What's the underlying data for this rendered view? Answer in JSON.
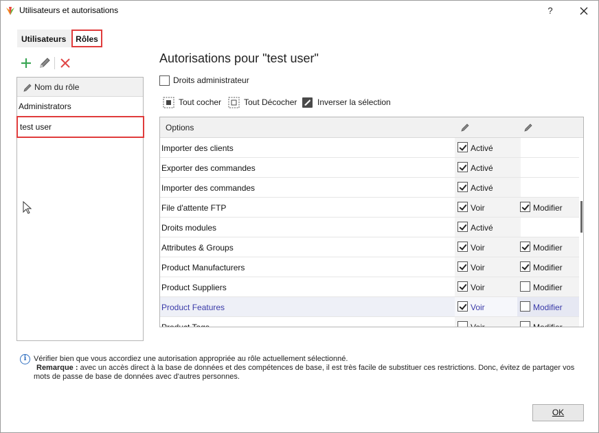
{
  "window": {
    "title": "Utilisateurs et autorisations",
    "help_label": "?"
  },
  "tabs": [
    {
      "label": "Utilisateurs",
      "active": false
    },
    {
      "label": "Rôles",
      "active": true
    }
  ],
  "role_toolbar": {
    "icons": [
      "add-icon",
      "edit-icon",
      "delete-icon"
    ]
  },
  "roles": {
    "header": "Nom du rôle",
    "items": [
      {
        "label": "Administrators",
        "selected": false
      },
      {
        "label": "test user",
        "selected": true
      }
    ]
  },
  "permissions": {
    "title": "Autorisations pour \"test user\"",
    "admin_rights": {
      "label": "Droits administrateur",
      "checked": false
    },
    "toolbar": {
      "check_all": "Tout cocher",
      "uncheck_all": "Tout Décocher",
      "invert": "Inverser la sélection"
    },
    "grid_header": "Options",
    "rows": [
      {
        "name": "Importer des clients",
        "c1_label": "Activé",
        "c1": true,
        "c2_label": "",
        "c2": null
      },
      {
        "name": "Exporter des commandes",
        "c1_label": "Activé",
        "c1": true,
        "c2_label": "",
        "c2": null
      },
      {
        "name": "Importer des commandes",
        "c1_label": "Activé",
        "c1": true,
        "c2_label": "",
        "c2": null
      },
      {
        "name": "File d'attente FTP",
        "c1_label": "Voir",
        "c1": true,
        "c2_label": "Modifier",
        "c2": true
      },
      {
        "name": "Droits modules",
        "c1_label": "Activé",
        "c1": true,
        "c2_label": "",
        "c2": null
      },
      {
        "name": "Attributes & Groups",
        "c1_label": "Voir",
        "c1": true,
        "c2_label": "Modifier",
        "c2": true
      },
      {
        "name": "Product Manufacturers",
        "c1_label": "Voir",
        "c1": true,
        "c2_label": "Modifier",
        "c2": true
      },
      {
        "name": "Product Suppliers",
        "c1_label": "Voir",
        "c1": true,
        "c2_label": "Modifier",
        "c2": false
      },
      {
        "name": "Product Features",
        "c1_label": "Voir",
        "c1": true,
        "c2_label": "Modifier",
        "c2": false,
        "highlight": true
      },
      {
        "name": "Product Tags",
        "c1_label": "Voir",
        "c1": false,
        "c2_label": "Modifier",
        "c2": false
      }
    ]
  },
  "note": {
    "line1": "Vérifier bien que vous accordiez une autorisation appropriée au rôle actuellement sélectionné.",
    "remark_label": "Remarque :",
    "line2_rest": " avec un accès direct à la base de données et des compétences de base, il est très facile de substituer ces restrictions. Donc, évitez de partager vos",
    "line3": "mots de passe de base de données avec d'autres personnes."
  },
  "buttons": {
    "ok": "OK"
  },
  "colors": {
    "highlight_border": "#e03b3b",
    "add_icon": "#3aa655",
    "delete_icon": "#e04646",
    "info_icon": "#2f6fc0",
    "selected_row_text": "#3a3aa8"
  }
}
